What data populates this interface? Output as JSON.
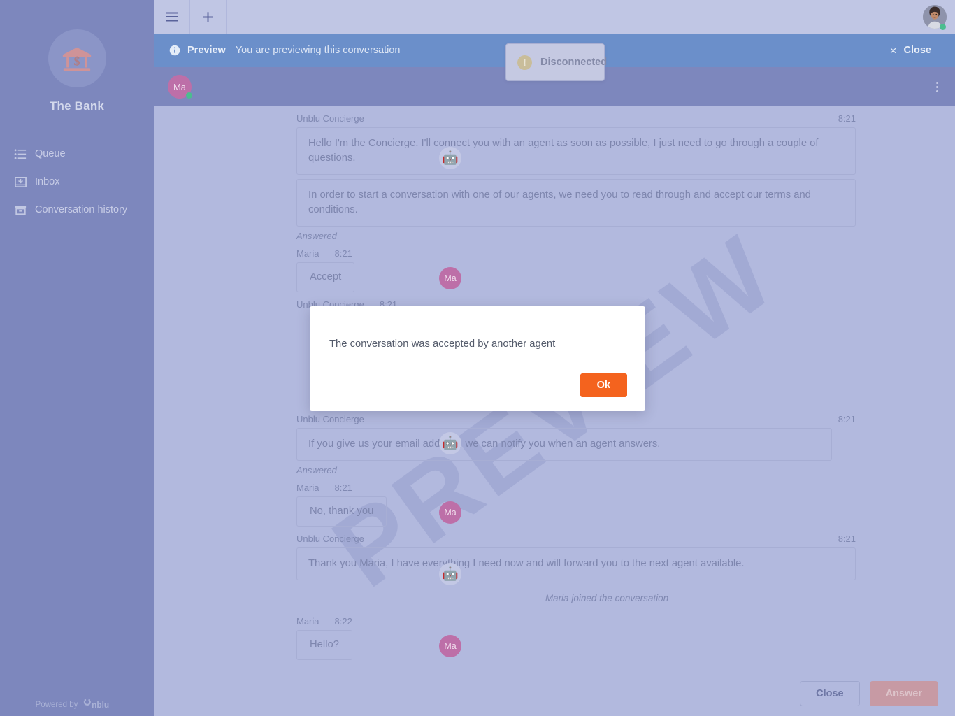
{
  "sidebar": {
    "logo_icon": "bank-building-dollar-icon",
    "brand": "The Bank",
    "items": [
      {
        "label": "Queue",
        "icon": "list-icon"
      },
      {
        "label": "Inbox",
        "icon": "inbox-tray-icon"
      },
      {
        "label": "Conversation history",
        "icon": "archive-box-icon"
      }
    ],
    "footer": {
      "powered_text": "Powered by",
      "brand": "unblu"
    }
  },
  "toolbar": {
    "menu_icon": "hamburger-menu-icon",
    "add_icon": "plus-icon",
    "avatar_icon": "user-avatar-photo",
    "status": "online"
  },
  "preview_banner": {
    "info_icon": "info-circle-icon",
    "label": "Preview",
    "message": "You are previewing this conversation",
    "close_x": "×",
    "close_label": "Close",
    "bg_color": "#6b8fca"
  },
  "conversation_header": {
    "avatar_initials": "Ma",
    "status": "online",
    "menu_icon": "kebab-menu-icon"
  },
  "toast": {
    "icon": "warning-exclamation-icon",
    "label": "Disconnected"
  },
  "watermark": "PREVIEW",
  "chat": {
    "groups": [
      {
        "sender": "Unblu Concierge",
        "time": "8:21",
        "time_position": "right",
        "avatar": "robot",
        "avatar_glyph": "🤖",
        "bubbles": [
          "Hello I'm the Concierge. I'll connect you with an agent as soon as possible, I just need to go through a couple of questions.",
          "In order to start a conversation with one of our agents, we need you to read through and accept our terms and conditions."
        ],
        "status_note": "Answered"
      },
      {
        "sender": "Maria",
        "time": "8:21",
        "time_position": "inline",
        "avatar": "initials",
        "avatar_glyph": "Ma",
        "bubbles": [
          "Accept"
        ],
        "inline": true,
        "status_note": ""
      },
      {
        "sender": "Unblu Concierge",
        "time": "8:21",
        "time_position": "right",
        "avatar": "robot",
        "avatar_glyph": "🤖",
        "bubbles": [],
        "status_note": ""
      },
      {
        "sender": "Unblu Concierge",
        "time": "8:21",
        "time_position": "right",
        "avatar": "robot",
        "avatar_glyph": "🤖",
        "bubbles": [
          "If you give us your email address, we can notify you when an agent answers."
        ],
        "status_note": "Answered"
      },
      {
        "sender": "Maria",
        "time": "8:21",
        "time_position": "inline",
        "avatar": "initials",
        "avatar_glyph": "Ma",
        "bubbles": [
          "No, thank you"
        ],
        "inline": true,
        "status_note": ""
      },
      {
        "sender": "Unblu Concierge",
        "time": "8:21",
        "time_position": "right",
        "avatar": "robot",
        "avatar_glyph": "🤖",
        "bubbles": [
          "Thank you Maria, I have everything I need now and will forward you to the next agent available."
        ],
        "status_note": ""
      }
    ],
    "system_note": "Maria joined the conversation",
    "last_group": {
      "sender": "Maria",
      "time": "8:22",
      "avatar_glyph": "Ma",
      "bubble": "Hello?"
    }
  },
  "bottom_actions": {
    "close_label": "Close",
    "answer_label": "Answer"
  },
  "modal": {
    "message": "The conversation was accepted by another agent",
    "ok_label": "Ok",
    "ok_color": "#f4631e"
  }
}
